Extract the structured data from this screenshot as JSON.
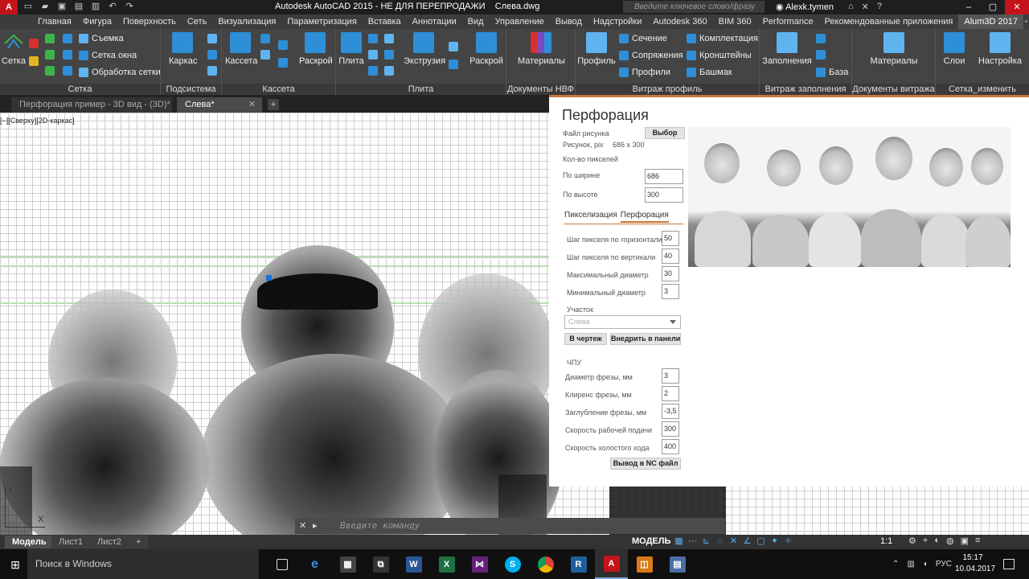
{
  "titlebar": {
    "logo": "A",
    "app_title": "Autodesk AutoCAD 2015 - НЕ ДЛЯ ПЕРЕПРОДАЖИ",
    "file_name": "Слева.dwg",
    "search_placeholder": "Введите ключевое слово/фразу",
    "user_name": "Alexk.tymen",
    "help_icon": "?"
  },
  "ribbon_tabs": [
    "Главная",
    "Фигура",
    "Поверхность",
    "Сеть",
    "Визуализация",
    "Параметризация",
    "Вставка",
    "Аннотации",
    "Вид",
    "Управление",
    "Вывод",
    "Надстройки",
    "Autodesk 360",
    "BIM 360",
    "Performance",
    "Рекомендованные приложения",
    "Alum3D 2017"
  ],
  "ribbon_active_tab": "Alum3D 2017",
  "ribbon": {
    "setka": {
      "label": "Сетка",
      "big": "Сетка",
      "items": [
        "Съемка",
        "Сетка окна",
        "Обработка сетки"
      ]
    },
    "podsistema": {
      "label": "Подсистема",
      "big": "Каркас"
    },
    "kasseta": {
      "label": "Кассета",
      "big1": "Кассета",
      "big2": "Раскрой"
    },
    "plita": {
      "label": "Плита",
      "big1": "Плита",
      "big2": "Экструзия",
      "big3": "Раскрой"
    },
    "docs_nvf": {
      "label": "Документы НВФ",
      "big": "Материалы"
    },
    "vitrazh": {
      "label": "Витраж профиль",
      "big": "Профиль",
      "items": [
        "Сечение",
        "Сопряжения",
        "Профили",
        "Комплектация",
        "Кронштейны",
        "Башмак"
      ]
    },
    "vitrazh_fill": {
      "label": "Витраж заполнения",
      "big": "Заполнения",
      "items": [
        "База"
      ]
    },
    "docs_vitrazh": {
      "label": "Документы витража",
      "big": "Материалы"
    },
    "setka_change": {
      "label": "Сетка_изменить",
      "big1": "Слои",
      "big2": "Настройка"
    }
  },
  "doc_tabs": [
    "Перфорация пример - 3D вид - (3D)*",
    "Слева*"
  ],
  "doc_tab_plus": "+",
  "view_label": "[−][Сверху][2D-каркас]",
  "ucs": {
    "y": "Y",
    "x": "X"
  },
  "dialog": {
    "title": "Перфорация",
    "file_label": "Файл рисунка",
    "browse_button": "Выбор",
    "image_size_label": "Рисунок, pix",
    "image_size_value": "686 x 300",
    "pixel_count_label": "Кол-во пикселей",
    "width_label": "По ширине",
    "width_value": "686",
    "height_label": "По высоте",
    "height_value": "300",
    "tabs": [
      "Пикселизация",
      "Перфорация"
    ],
    "active_tab": "Перфорация",
    "h_step_label": "Шаг пикселя по горизонтали",
    "h_step_value": "50",
    "v_step_label": "Шаг пикселя по вертикали",
    "v_step_value": "40",
    "max_d_label": "Максимальный диаметр",
    "max_d_value": "30",
    "min_d_label": "Минимальный диаметр",
    "min_d_value": "3",
    "area_label": "Участок",
    "area_value": "Слева",
    "in_drawing_button": "В чертеж",
    "embed_button": "Внедрить в панели",
    "cnc_label": "ЧПУ",
    "mill_d_label": "Диаметр фрезы, мм",
    "mill_d_value": "3",
    "clearance_label": "Клиренс фрезы, мм",
    "clearance_value": "2",
    "depth_label": "Заглубление фрезы, мм",
    "depth_value": "-3,5",
    "work_speed_label": "Скорость рабочей подачи",
    "work_speed_value": "300",
    "idle_speed_label": "Скорость холостого хода",
    "idle_speed_value": "400",
    "nc_button": "Вывод в NC файл"
  },
  "command_line": {
    "placeholder": "Введите команду"
  },
  "layout_tabs": [
    "Модель",
    "Лист1",
    "Лист2"
  ],
  "layout_plus": "+",
  "status": {
    "model": "МОДЕЛЬ",
    "scale": "1:1"
  },
  "taskbar": {
    "search": "Поиск в Windows",
    "tray_lang": "РУС",
    "time": "15:17",
    "date": "10.04.2017"
  }
}
